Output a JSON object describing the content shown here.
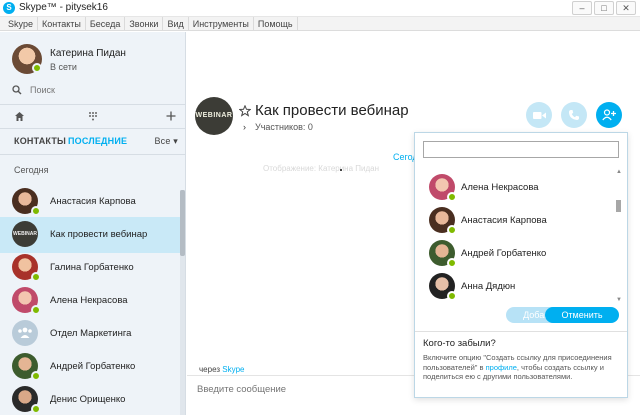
{
  "window": {
    "title": "Skype™ - pitysek16",
    "controls": [
      "–",
      "□",
      "✕"
    ]
  },
  "menu": [
    "Skype",
    "Контакты",
    "Беседа",
    "Звонки",
    "Вид",
    "Инструменты",
    "Помощь"
  ],
  "profile": {
    "name": "Катерина Пидан",
    "status": "В сети"
  },
  "search": {
    "placeholder": "Поиск"
  },
  "tabs": {
    "contacts": "КОНТАКТЫ",
    "recent": "ПОСЛЕДНИЕ",
    "filter": "Все"
  },
  "section_label": "Сегодня",
  "contacts": [
    {
      "name": "Анастасия Карпова",
      "status": "online",
      "avatar": "photo-brown"
    },
    {
      "name": "Как провести вебинар",
      "status": "group",
      "avatar": "group-webinar",
      "selected": true
    },
    {
      "name": "Галина Горбатенко",
      "status": "online",
      "avatar": "photo-red"
    },
    {
      "name": "Алена Некрасова",
      "status": "online",
      "avatar": "photo-pink"
    },
    {
      "name": "Отдел Маркетинга",
      "status": "group",
      "avatar": "group-icon"
    },
    {
      "name": "Андрей Горбатенко",
      "status": "online",
      "avatar": "photo-green"
    },
    {
      "name": "Денис Орищенко",
      "status": "online",
      "avatar": "photo-dark"
    }
  ],
  "conversation": {
    "avatar_text": "WEBINAR",
    "title": "Как провести вебинар",
    "participants": "Участников: 0",
    "today_link": "Сегод",
    "faded_text": "Отображение: Катерина Пидан",
    "via_prefix": "через",
    "via_service": "Skype",
    "compose_placeholder": "Введите сообщение"
  },
  "add_people_popup": {
    "search_value": "",
    "people": [
      {
        "name": "Алена Некрасова",
        "avatar": "photo-pink"
      },
      {
        "name": "Анастасия Карпова",
        "avatar": "photo-brown"
      },
      {
        "name": "Андрей Горбатенко",
        "avatar": "photo-green"
      },
      {
        "name": "Анна Дядюн",
        "avatar": "photo-dark2"
      }
    ],
    "add_label": "Добавить",
    "cancel_label": "Отменить",
    "forgot_title": "Кого-то забыли?",
    "forgot_text_1": "Включите опцию \"Создать ссылку для присоединения пользователей\" в ",
    "forgot_link": "профиле",
    "forgot_text_2": ", чтобы создать ссылку и поделиться ею с другими пользователями."
  },
  "colors": {
    "accent": "#00aff0",
    "online": "#7fba00",
    "sidebar_bg": "#eef3f8",
    "selected_row": "#c9e9f7"
  }
}
